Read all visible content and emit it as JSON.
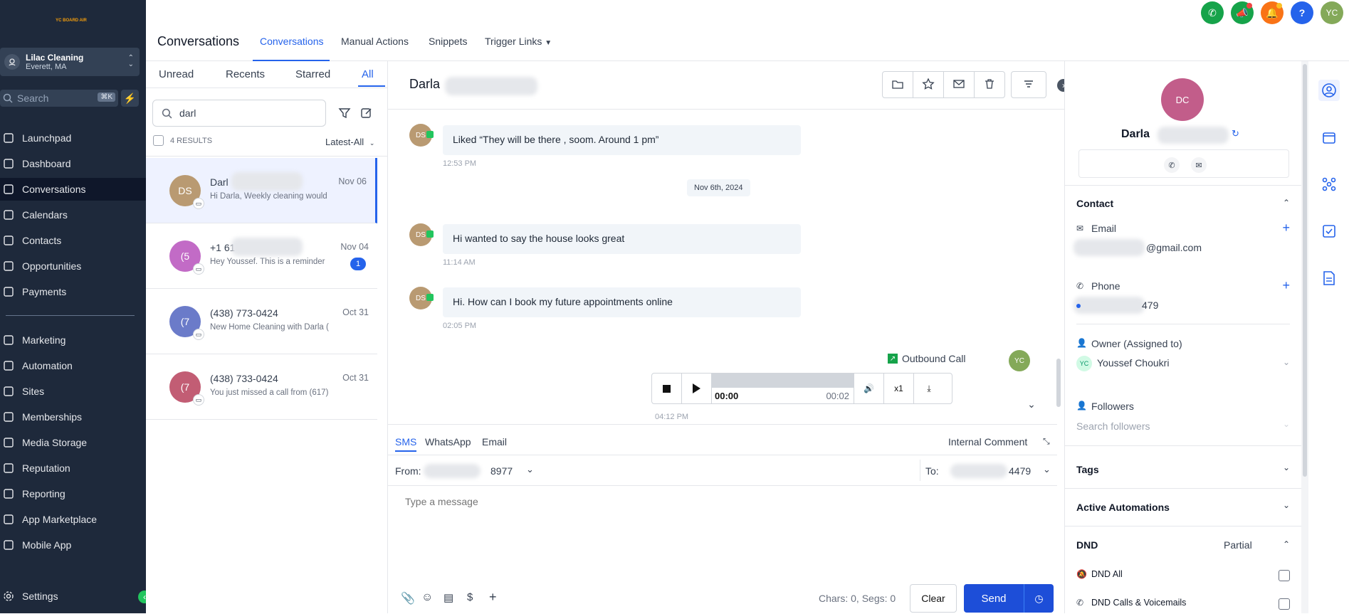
{
  "sidebar": {
    "logo_text": "YC BOARD AIR",
    "location": {
      "name": "Lilac Cleaning",
      "city": "Everett, MA"
    },
    "search_placeholder": "Search",
    "search_shortcut": "⌘K",
    "nav_top": [
      {
        "label": "Launchpad",
        "icon": "rocket-icon"
      },
      {
        "label": "Dashboard",
        "icon": "grid-icon"
      },
      {
        "label": "Conversations",
        "icon": "chat-icon"
      },
      {
        "label": "Calendars",
        "icon": "calendar-icon"
      },
      {
        "label": "Contacts",
        "icon": "contacts-icon"
      },
      {
        "label": "Opportunities",
        "icon": "opportunities-icon"
      },
      {
        "label": "Payments",
        "icon": "payments-icon"
      }
    ],
    "nav_bottom": [
      {
        "label": "Marketing",
        "icon": "send-icon"
      },
      {
        "label": "Automation",
        "icon": "automation-icon"
      },
      {
        "label": "Sites",
        "icon": "sites-icon"
      },
      {
        "label": "Memberships",
        "icon": "memberships-icon"
      },
      {
        "label": "Media Storage",
        "icon": "image-icon"
      },
      {
        "label": "Reputation",
        "icon": "star-icon"
      },
      {
        "label": "Reporting",
        "icon": "chart-icon"
      },
      {
        "label": "App Marketplace",
        "icon": "apps-icon"
      },
      {
        "label": "Mobile App",
        "icon": "mobile-icon"
      }
    ],
    "settings_label": "Settings",
    "active": "Conversations"
  },
  "header": {
    "title": "Conversations",
    "tabs": [
      "Conversations",
      "Manual Actions",
      "Snippets",
      "Trigger Links"
    ],
    "user_initials": "YC"
  },
  "list": {
    "filter_tabs": [
      "Unread",
      "Recents",
      "Starred",
      "All"
    ],
    "search_value": "darl",
    "results": "4 RESULTS",
    "sort": "Latest-All",
    "conversations": [
      {
        "initials": "DS",
        "name": "Darl",
        "preview": "Hi Darla, Weekly cleaning would",
        "date": "Nov 06",
        "avatar_color": "#b99a72"
      },
      {
        "initials": "(5",
        "name": "+1 61",
        "preview": "Hey Youssef. This is a reminder",
        "date": "Nov 04",
        "avatar_color": "#c26bc6",
        "unread": "1"
      },
      {
        "initials": "(7",
        "name": "(438) 773-0424",
        "preview": "New Home Cleaning with Darla (",
        "date": "Oct 31",
        "avatar_color": "#6b7bc9"
      },
      {
        "initials": "(7",
        "name": "(438) 733-0424",
        "preview": "You just missed a call from (617)",
        "date": "Oct 31",
        "avatar_color": "#c25d74"
      }
    ]
  },
  "chat": {
    "contact_name": "Darla",
    "messages": [
      {
        "avatar": "DS",
        "text": "Liked “They will be there , soom. Around 1 pm”",
        "time": "12:53 PM"
      },
      {
        "avatar": "DS",
        "text": "Hi wanted to say the house looks great",
        "time": "11:14 AM"
      },
      {
        "avatar": "DS",
        "text": "Hi. How can I book my future appointments online",
        "time": "02:05 PM"
      }
    ],
    "date_divider": "Nov 6th, 2024",
    "call": {
      "label": "Outbound Call",
      "avatar": "YC",
      "current": "00:00",
      "duration": "00:02",
      "speed": "x1",
      "time": "04:12 PM",
      "progress": 0
    }
  },
  "composer": {
    "tabs": [
      "SMS",
      "WhatsApp",
      "Email"
    ],
    "internal_comment": "Internal Comment",
    "from_label": "From:",
    "from_value": "8977",
    "to_label": "To:",
    "to_value": "4479",
    "placeholder": "Type a message",
    "counter": "Chars: 0, Segs: 0",
    "clear": "Clear",
    "send": "Send"
  },
  "contact_panel": {
    "initials": "DC",
    "name": "Darla",
    "contact_section": "Contact",
    "email_label": "Email",
    "email_value": "@gmail.com",
    "phone_label": "Phone",
    "phone_value": "479",
    "owner_label": "Owner (Assigned to)",
    "owner_initials": "YC",
    "owner_name": "Youssef Choukri",
    "followers_label": "Followers",
    "followers_placeholder": "Search followers",
    "tags": "Tags",
    "active_automations": "Active Automations",
    "dnd": "DND",
    "dnd_state": "Partial",
    "dnd_all": "DND All",
    "dnd_calls": "DND Calls & Voicemails"
  }
}
